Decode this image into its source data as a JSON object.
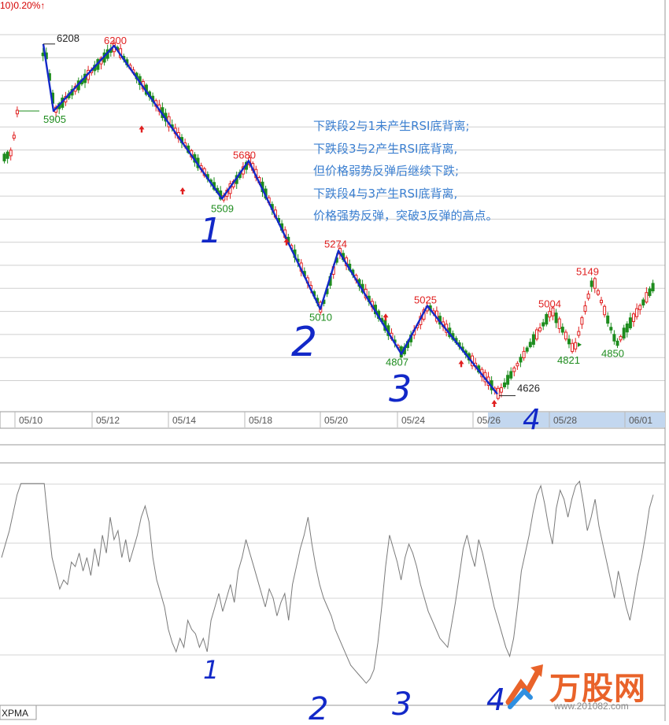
{
  "header": {
    "title": "10)0.20%↑"
  },
  "indicator": {
    "name": "XPMA"
  },
  "annotation": {
    "lines": [
      "下跌段2与1未产生RSI底背离;",
      "下跌段3与2产生RSI底背离,",
      "但价格弱势反弹后继续下跌;",
      "下跌段4与3产生RSI底背离,",
      "价格强势反弹，突破3反弹的高点。"
    ]
  },
  "watermark": {
    "title": "万股网",
    "url": "www.201082.com"
  },
  "colors": {
    "up": "#e02020",
    "down": "#1e8c1e",
    "wave": "#1228c8",
    "axis_band": "#c3d7ef",
    "rsi_line": "#7a7a7a",
    "note": "#3b7fd0"
  },
  "chart_data": {
    "type": "candlestick",
    "x_tick_labels": [
      "05/10",
      "05/12",
      "05/14",
      "05/18",
      "05/20",
      "05/24",
      "05/26",
      "05/28",
      "06/01"
    ],
    "price_range": [
      4550,
      6300
    ],
    "turning_points": [
      {
        "label": "6208",
        "value": 6208,
        "kind": "high"
      },
      {
        "label": "5905",
        "value": 5905,
        "kind": "low"
      },
      {
        "label": "6200",
        "value": 6200,
        "kind": "high"
      },
      {
        "label": "5509",
        "value": 5509,
        "kind": "low"
      },
      {
        "label": "5680",
        "value": 5680,
        "kind": "high"
      },
      {
        "label": "5010",
        "value": 5010,
        "kind": "low"
      },
      {
        "label": "5274",
        "value": 5274,
        "kind": "high"
      },
      {
        "label": "4807",
        "value": 4807,
        "kind": "low"
      },
      {
        "label": "5025",
        "value": 5025,
        "kind": "high"
      },
      {
        "label": "4626",
        "value": 4626,
        "kind": "low"
      },
      {
        "label": "5004",
        "value": 5004,
        "kind": "high"
      },
      {
        "label": "4821",
        "value": 4821,
        "kind": "low"
      },
      {
        "label": "5149",
        "value": 5149,
        "kind": "high"
      },
      {
        "label": "4850",
        "value": 4850,
        "kind": "low"
      }
    ],
    "wave_line": [
      6208,
      5905,
      6200,
      5509,
      5680,
      5010,
      5274,
      4807,
      5025,
      4626
    ],
    "segment_labels_price": [
      "1",
      "2",
      "3",
      "4"
    ],
    "segment_labels_rsi": [
      "1",
      "2",
      "3",
      "4"
    ],
    "rsi_range": [
      0,
      100
    ],
    "rsi_values": [
      62,
      68,
      74,
      82,
      90,
      95,
      95,
      95,
      95,
      95,
      95,
      95,
      78,
      62,
      55,
      48,
      52,
      50,
      60,
      58,
      64,
      56,
      62,
      54,
      66,
      58,
      72,
      64,
      80,
      70,
      74,
      62,
      70,
      60,
      66,
      72,
      80,
      85,
      78,
      62,
      52,
      46,
      40,
      30,
      24,
      20,
      26,
      22,
      34,
      30,
      28,
      22,
      26,
      20,
      34,
      40,
      46,
      38,
      44,
      50,
      42,
      56,
      62,
      70,
      64,
      58,
      52,
      46,
      40,
      48,
      44,
      36,
      42,
      46,
      34,
      50,
      58,
      66,
      72,
      80,
      68,
      58,
      50,
      44,
      40,
      36,
      30,
      26,
      22,
      18,
      14,
      12,
      10,
      8,
      6,
      8,
      12,
      24,
      40,
      58,
      72,
      66,
      60,
      52,
      62,
      68,
      64,
      58,
      50,
      44,
      38,
      34,
      30,
      26,
      24,
      22,
      32,
      42,
      54,
      66,
      72,
      64,
      58,
      70,
      64,
      56,
      48,
      40,
      34,
      28,
      22,
      18,
      26,
      40,
      56,
      64,
      72,
      82,
      90,
      94,
      86,
      76,
      68,
      84,
      92,
      88,
      80,
      88,
      94,
      96,
      86,
      74,
      80,
      88,
      76,
      68,
      60,
      52,
      44,
      56,
      48,
      40,
      34,
      44,
      54,
      62,
      72,
      84,
      90
    ]
  }
}
